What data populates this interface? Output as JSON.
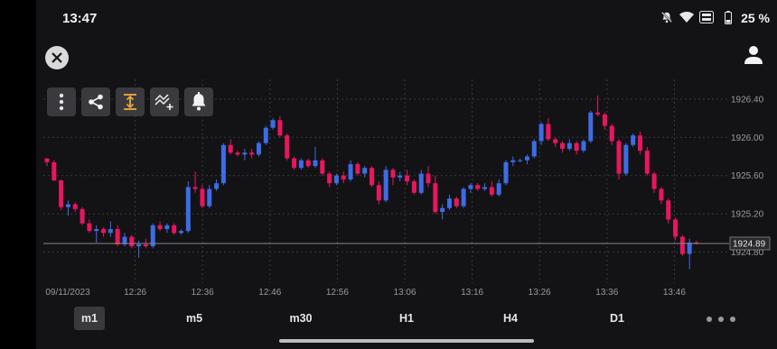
{
  "status_bar": {
    "time": "13:47",
    "battery": "25 %",
    "icons": [
      "bell-muted-icon",
      "wifi-icon",
      "volte-wifi-icon"
    ]
  },
  "top_bar": {
    "close_icon": "close-icon",
    "profile_icon": "profile-icon"
  },
  "toolbar": {
    "items": [
      "more-vertical-icon",
      "share-icon",
      "auto-scale-icon",
      "indicators-icon",
      "alert-bell-icon"
    ]
  },
  "colors": {
    "bull": "#3d6ce6",
    "bear": "#e8175d",
    "price_line": "#8a8a8a",
    "background": "#131316"
  },
  "chart_data": {
    "type": "candlestick",
    "ylim": [
      1924.55,
      1926.55
    ],
    "y_ticks": [
      "1926.40",
      "1926.00",
      "1925.60",
      "1925.20",
      "1924.80"
    ],
    "x_ticks": [
      "09/11/2023",
      "12:26",
      "12:36",
      "12:46",
      "12:56",
      "13:06",
      "13:16",
      "13:26",
      "13:36",
      "13:46"
    ],
    "current_price": "1924.89",
    "candles": [
      [
        1925.78,
        1925.78,
        1925.7,
        1925.74
      ],
      [
        1925.74,
        1925.76,
        1925.54,
        1925.55
      ],
      [
        1925.55,
        1925.56,
        1925.24,
        1925.27
      ],
      [
        1925.27,
        1925.34,
        1925.18,
        1925.3
      ],
      [
        1925.3,
        1925.32,
        1925.22,
        1925.25
      ],
      [
        1925.25,
        1925.27,
        1925.08,
        1925.1
      ],
      [
        1925.1,
        1925.14,
        1925.0,
        1925.02
      ],
      [
        1925.02,
        1925.08,
        1924.9,
        1925.04
      ],
      [
        1925.04,
        1925.06,
        1924.96,
        1925.0
      ],
      [
        1925.0,
        1925.12,
        1924.96,
        1925.04
      ],
      [
        1925.04,
        1925.08,
        1924.86,
        1924.88
      ],
      [
        1924.88,
        1925.0,
        1924.86,
        1924.96
      ],
      [
        1924.96,
        1924.98,
        1924.84,
        1924.86
      ],
      [
        1924.86,
        1924.92,
        1924.74,
        1924.88
      ],
      [
        1924.88,
        1924.94,
        1924.84,
        1924.86
      ],
      [
        1924.86,
        1925.1,
        1924.84,
        1925.08
      ],
      [
        1925.08,
        1925.12,
        1925.02,
        1925.04
      ],
      [
        1925.04,
        1925.1,
        1925.0,
        1925.08
      ],
      [
        1925.08,
        1925.1,
        1924.98,
        1925.0
      ],
      [
        1925.0,
        1925.04,
        1924.98,
        1925.02
      ],
      [
        1925.02,
        1925.54,
        1925.0,
        1925.48
      ],
      [
        1925.48,
        1925.64,
        1925.42,
        1925.46
      ],
      [
        1925.46,
        1925.5,
        1925.26,
        1925.28
      ],
      [
        1925.28,
        1925.5,
        1925.26,
        1925.46
      ],
      [
        1925.46,
        1925.56,
        1925.44,
        1925.52
      ],
      [
        1925.52,
        1925.94,
        1925.5,
        1925.92
      ],
      [
        1925.92,
        1925.98,
        1925.82,
        1925.84
      ],
      [
        1925.84,
        1925.86,
        1925.8,
        1925.82
      ],
      [
        1925.82,
        1925.88,
        1925.76,
        1925.84
      ],
      [
        1925.84,
        1925.88,
        1925.78,
        1925.82
      ],
      [
        1925.82,
        1925.96,
        1925.8,
        1925.94
      ],
      [
        1925.94,
        1926.12,
        1925.92,
        1926.1
      ],
      [
        1926.1,
        1926.2,
        1926.08,
        1926.18
      ],
      [
        1926.18,
        1926.22,
        1926.0,
        1926.02
      ],
      [
        1926.02,
        1926.04,
        1925.76,
        1925.78
      ],
      [
        1925.78,
        1925.8,
        1925.66,
        1925.68
      ],
      [
        1925.68,
        1925.78,
        1925.66,
        1925.76
      ],
      [
        1925.76,
        1925.78,
        1925.68,
        1925.7
      ],
      [
        1925.7,
        1925.9,
        1925.68,
        1925.76
      ],
      [
        1925.76,
        1925.78,
        1925.6,
        1925.62
      ],
      [
        1925.62,
        1925.64,
        1925.48,
        1925.52
      ],
      [
        1925.52,
        1925.62,
        1925.5,
        1925.6
      ],
      [
        1925.6,
        1925.64,
        1925.52,
        1925.56
      ],
      [
        1925.56,
        1925.76,
        1925.54,
        1925.72
      ],
      [
        1925.72,
        1925.74,
        1925.6,
        1925.62
      ],
      [
        1925.62,
        1925.7,
        1925.58,
        1925.68
      ],
      [
        1925.68,
        1925.7,
        1925.48,
        1925.5
      ],
      [
        1925.5,
        1925.54,
        1925.3,
        1925.34
      ],
      [
        1925.34,
        1925.7,
        1925.32,
        1925.66
      ],
      [
        1925.66,
        1925.68,
        1925.5,
        1925.58
      ],
      [
        1925.58,
        1925.64,
        1925.54,
        1925.6
      ],
      [
        1925.6,
        1925.66,
        1925.5,
        1925.54
      ],
      [
        1925.54,
        1925.56,
        1925.4,
        1925.42
      ],
      [
        1925.42,
        1925.66,
        1925.4,
        1925.62
      ],
      [
        1925.62,
        1925.7,
        1925.48,
        1925.52
      ],
      [
        1925.52,
        1925.6,
        1925.2,
        1925.22
      ],
      [
        1925.22,
        1925.3,
        1925.14,
        1925.26
      ],
      [
        1925.26,
        1925.4,
        1925.24,
        1925.36
      ],
      [
        1925.36,
        1925.38,
        1925.26,
        1925.28
      ],
      [
        1925.28,
        1925.48,
        1925.26,
        1925.46
      ],
      [
        1925.46,
        1925.52,
        1925.42,
        1925.5
      ],
      [
        1925.5,
        1925.52,
        1925.44,
        1925.46
      ],
      [
        1925.46,
        1925.52,
        1925.44,
        1925.48
      ],
      [
        1925.48,
        1925.54,
        1925.38,
        1925.4
      ],
      [
        1925.4,
        1925.56,
        1925.38,
        1925.52
      ],
      [
        1925.52,
        1925.76,
        1925.5,
        1925.74
      ],
      [
        1925.74,
        1925.8,
        1925.7,
        1925.76
      ],
      [
        1925.76,
        1925.78,
        1925.74,
        1925.76
      ],
      [
        1925.76,
        1925.82,
        1925.72,
        1925.8
      ],
      [
        1925.8,
        1925.98,
        1925.78,
        1925.96
      ],
      [
        1925.96,
        1926.16,
        1925.92,
        1926.14
      ],
      [
        1926.14,
        1926.2,
        1925.96,
        1925.98
      ],
      [
        1925.98,
        1926.0,
        1925.9,
        1925.94
      ],
      [
        1925.94,
        1925.96,
        1925.84,
        1925.88
      ],
      [
        1925.88,
        1925.98,
        1925.86,
        1925.94
      ],
      [
        1925.94,
        1925.96,
        1925.82,
        1925.86
      ],
      [
        1925.86,
        1925.98,
        1925.84,
        1925.96
      ],
      [
        1925.96,
        1926.28,
        1925.94,
        1926.26
      ],
      [
        1926.26,
        1926.44,
        1926.22,
        1926.24
      ],
      [
        1926.24,
        1926.26,
        1926.08,
        1926.12
      ],
      [
        1926.12,
        1926.14,
        1925.92,
        1925.96
      ],
      [
        1925.96,
        1925.98,
        1925.56,
        1925.62
      ],
      [
        1925.62,
        1925.94,
        1925.6,
        1925.92
      ],
      [
        1925.92,
        1926.04,
        1925.9,
        1926.02
      ],
      [
        1926.02,
        1926.06,
        1925.82,
        1925.86
      ],
      [
        1925.86,
        1925.9,
        1925.6,
        1925.62
      ],
      [
        1925.62,
        1925.64,
        1925.42,
        1925.46
      ],
      [
        1925.46,
        1925.48,
        1925.3,
        1925.34
      ],
      [
        1925.34,
        1925.36,
        1925.1,
        1925.14
      ],
      [
        1925.14,
        1925.16,
        1924.92,
        1924.96
      ],
      [
        1924.96,
        1924.98,
        1924.76,
        1924.78
      ],
      [
        1924.78,
        1924.94,
        1924.62,
        1924.9
      ],
      [
        1924.9,
        1924.92,
        1924.88,
        1924.89
      ]
    ]
  },
  "timeframes": [
    {
      "label": "m1",
      "active": true
    },
    {
      "label": "m5",
      "active": false
    },
    {
      "label": "m30",
      "active": false
    },
    {
      "label": "H1",
      "active": false
    },
    {
      "label": "H4",
      "active": false
    },
    {
      "label": "D1",
      "active": false
    }
  ]
}
